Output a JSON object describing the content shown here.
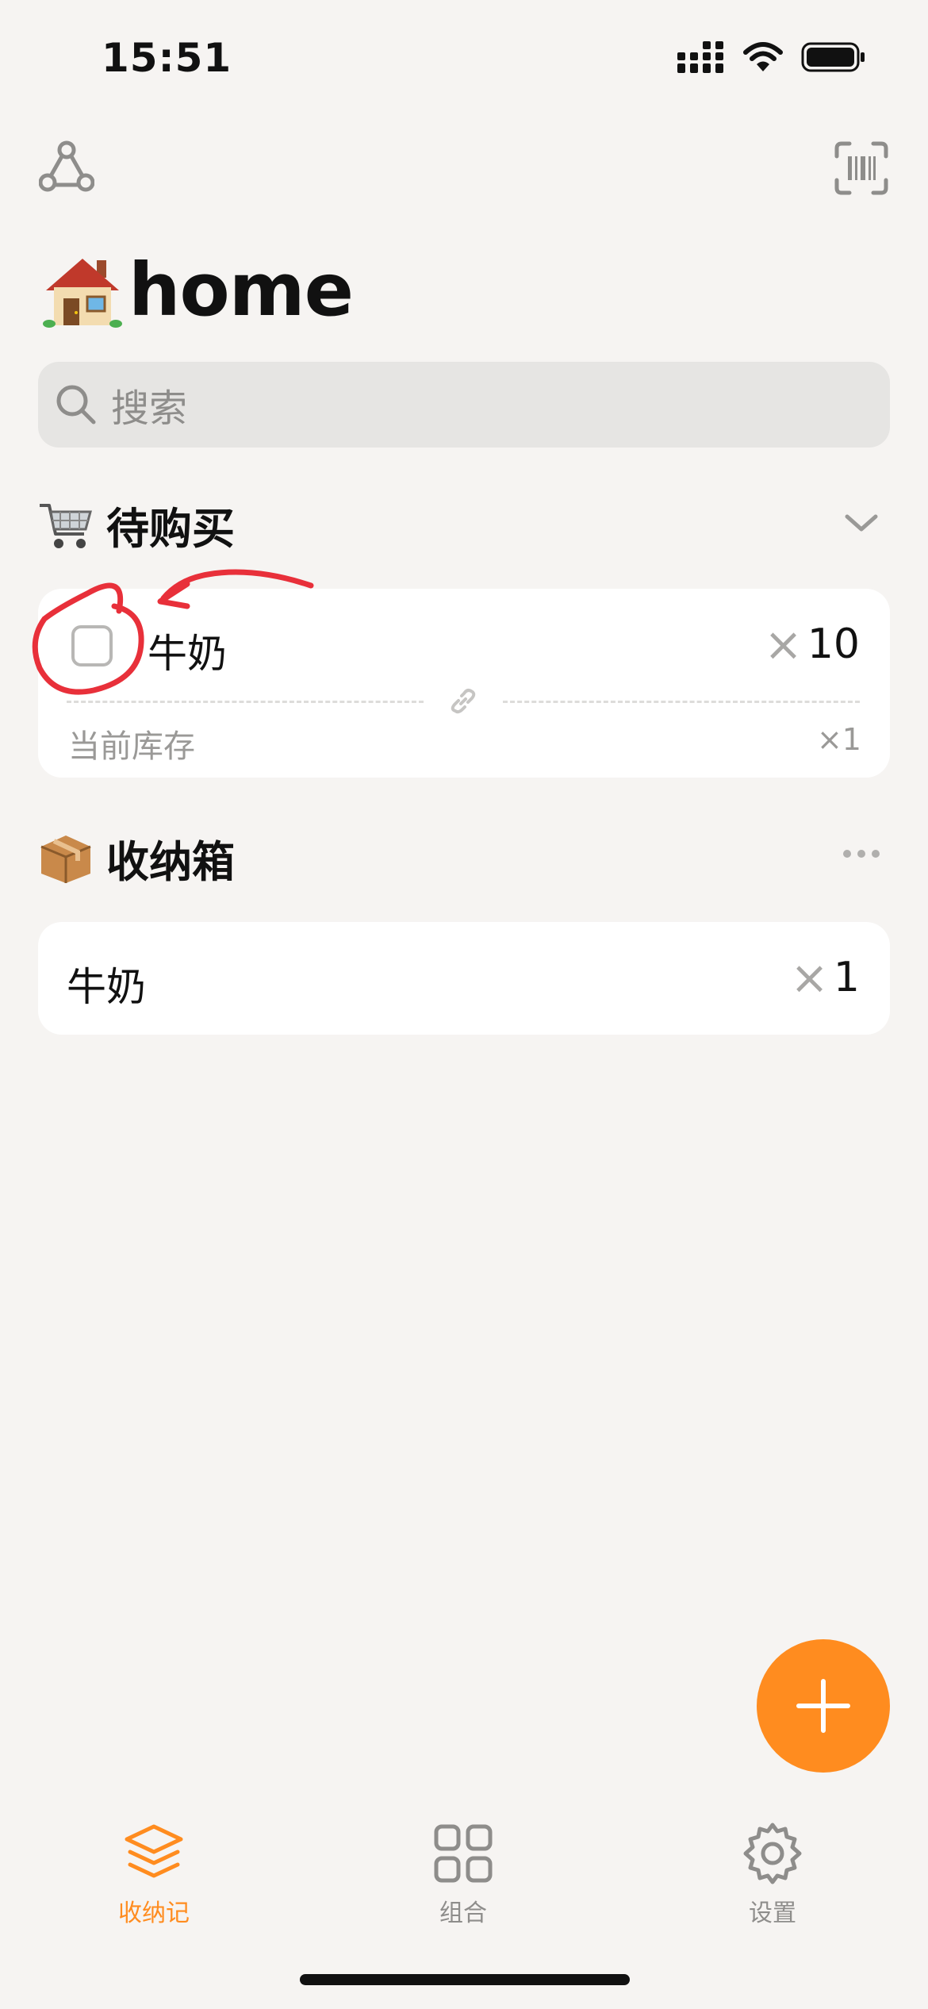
{
  "status_bar": {
    "time": "15:51"
  },
  "header": {
    "title_emoji": "house",
    "title": "home"
  },
  "search": {
    "placeholder": "搜索"
  },
  "to_buy": {
    "emoji": "shopping-cart",
    "title": "待购买",
    "items": [
      {
        "name": "牛奶",
        "qty_symbol": "×",
        "qty": "10",
        "stock_label": "当前库存",
        "stock_qty": "×1"
      }
    ]
  },
  "storage": {
    "emoji": "package",
    "title": "收纳箱",
    "items": [
      {
        "name": "牛奶",
        "qty_symbol": "×",
        "qty": "1"
      }
    ]
  },
  "tabs": [
    {
      "label": "收纳记",
      "icon": "layers-icon",
      "active": true
    },
    {
      "label": "组合",
      "icon": "grid-icon",
      "active": false
    },
    {
      "label": "设置",
      "icon": "gear-icon",
      "active": false
    }
  ],
  "colors": {
    "accent": "#ff8c1f",
    "annotation": "#e8303a",
    "background": "#f6f4f2",
    "muted": "#9a9997"
  }
}
